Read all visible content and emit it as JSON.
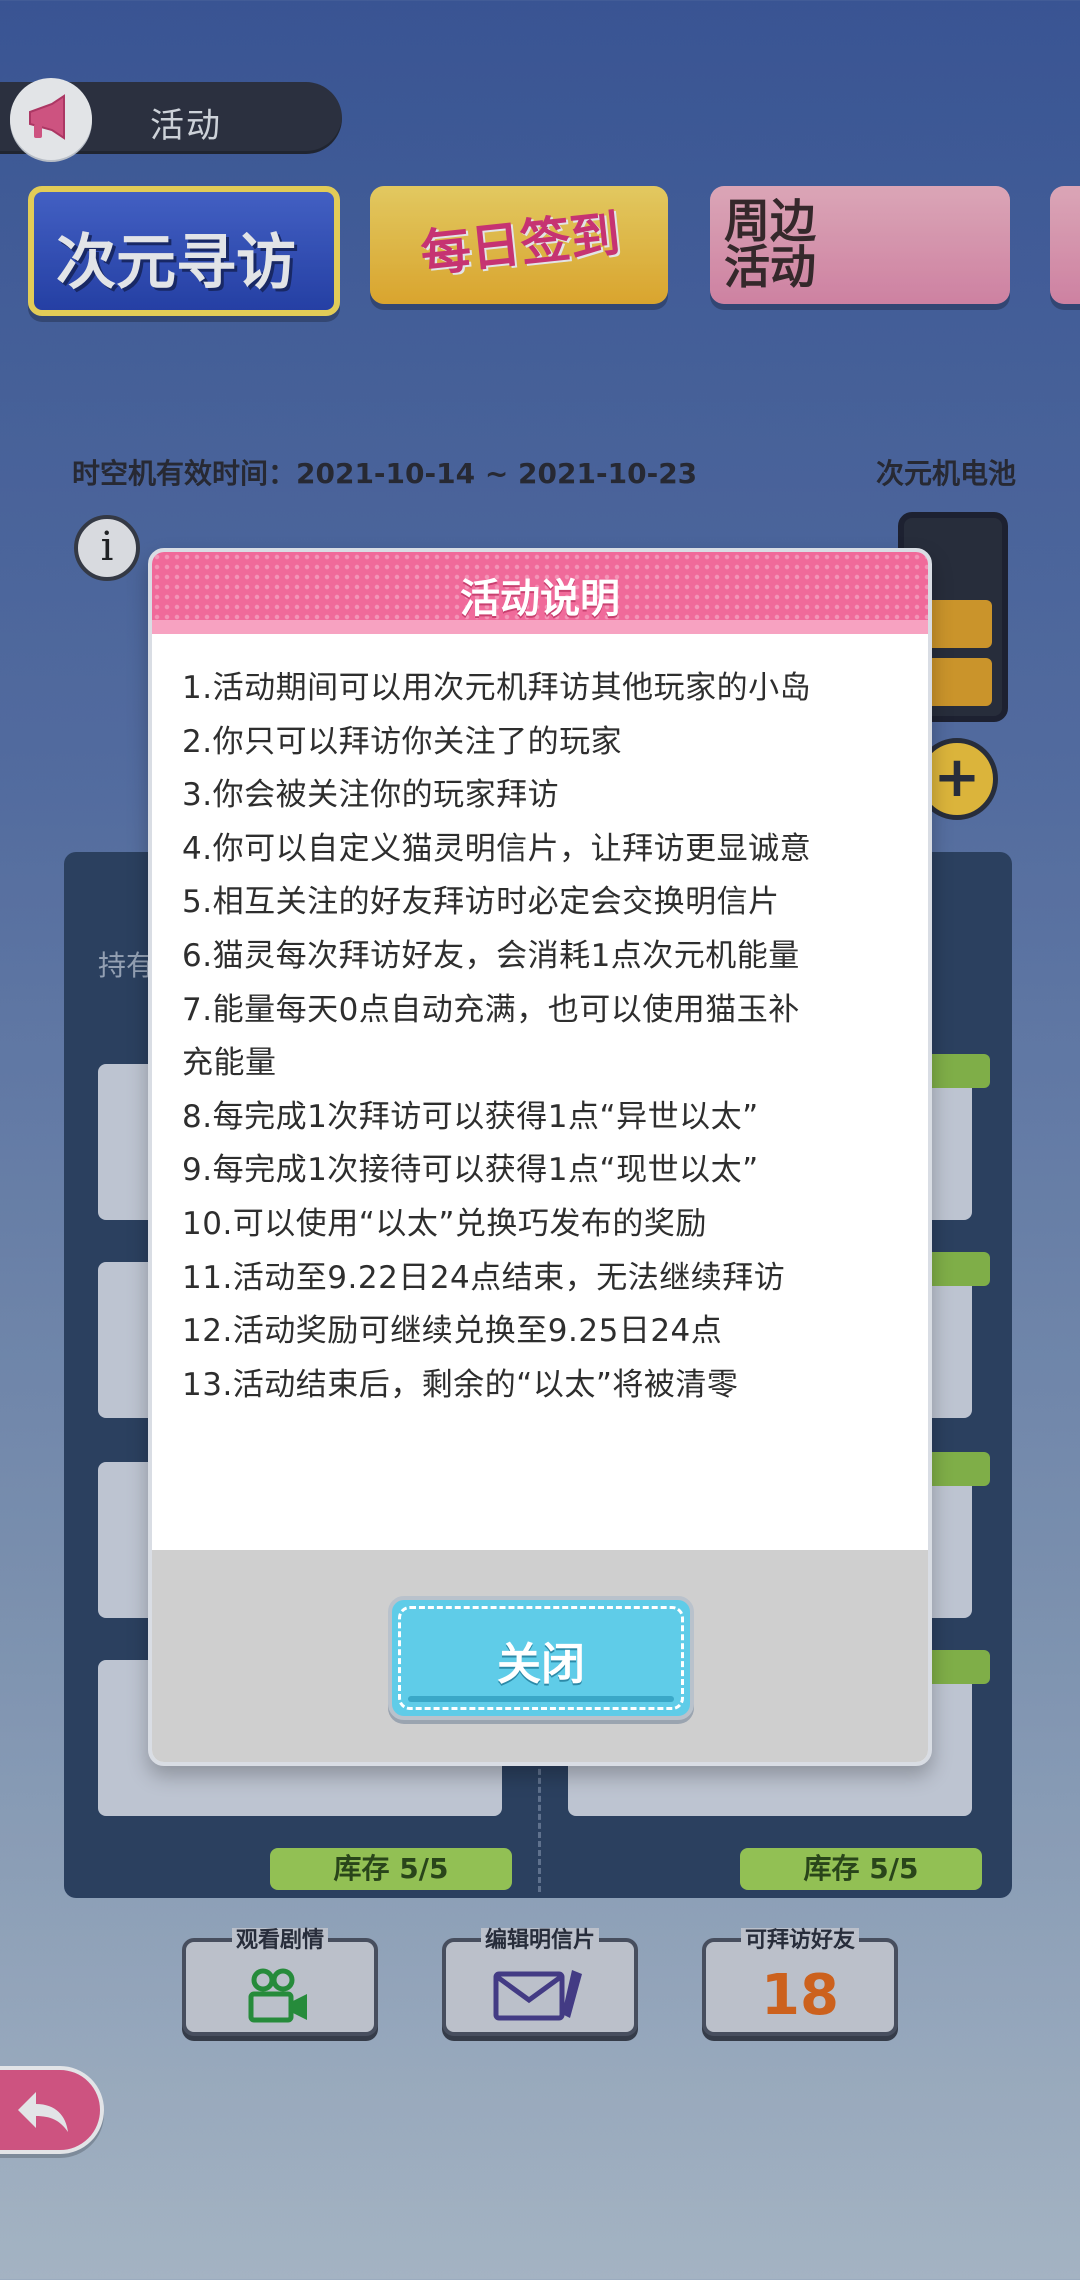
{
  "header": {
    "title": "活动",
    "icon": "megaphone-icon"
  },
  "tabs": [
    {
      "label": "次元寻访"
    },
    {
      "label": "每日签到"
    },
    {
      "label": "周边活动"
    }
  ],
  "info": {
    "time_text": "时空机有效时间：2021-10-14 ~ 2021-10-23",
    "battery_label": "次元机电池",
    "battery_level_cells": 2,
    "plus_symbol": "+",
    "info_symbol": "i"
  },
  "panel": {
    "hold_label": "持有",
    "stock_left": "库存 5/5",
    "stock_right": "库存 5/5"
  },
  "bottom_buttons": {
    "story": "观看剧情",
    "postcard": "编辑明信片",
    "friends": "可拜访好友",
    "friends_count": "18"
  },
  "modal": {
    "title": "活动说明",
    "rules": [
      "1.活动期间可以用次元机拜访其他玩家的小岛",
      "2.你只可以拜访你关注了的玩家",
      "3.你会被关注你的玩家拜访",
      "4.你可以自定义猫灵明信片，让拜访更显诚意",
      "5.相互关注的好友拜访时必定会交换明信片",
      "6.猫灵每次拜访好友，会消耗1点次元机能量",
      "7.能量每天0点自动充满，也可以使用猫玉补",
      "充能量",
      "8.每完成1次拜访可以获得1点“异世以太”",
      "9.每完成1次接待可以获得1点“现世以太”",
      "10.可以使用“以太”兑换巧发布的奖励",
      "11.活动至9.22日24点结束，无法继续拜访",
      "12.活动奖励可继续兑换至9.25日24点",
      "13.活动结束后，剩余的“以太”将被清零"
    ],
    "close_label": "关闭"
  },
  "colors": {
    "modal_header": "#f06a9a",
    "close_button": "#5fcce8",
    "accent_green": "#a4d658"
  }
}
